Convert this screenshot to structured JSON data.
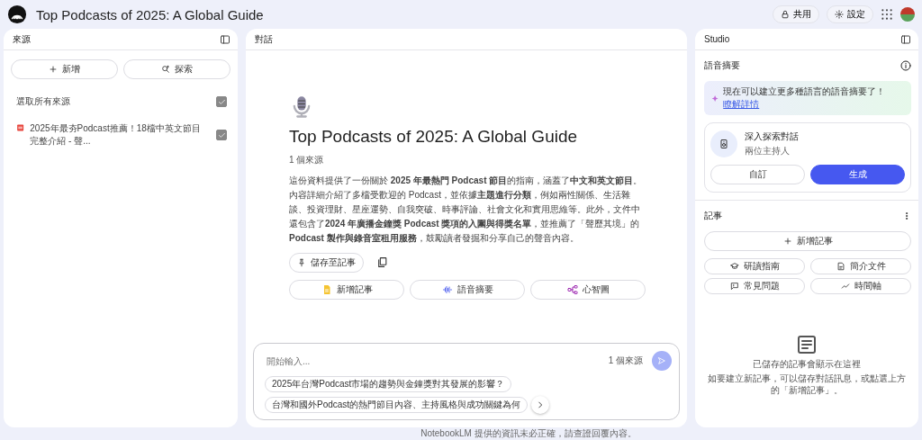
{
  "header": {
    "title": "Top Podcasts of 2025: A Global Guide",
    "buttons": [
      "共用",
      "設定"
    ]
  },
  "sources": {
    "title": "來源",
    "actions": [
      "新增",
      "探索"
    ],
    "select_all": {
      "label": "選取所有來源",
      "checked": true
    },
    "items": [
      {
        "title": "2025年最夯Podcast推薦！18檔中英文節目完整介紹 - 聲...",
        "checked": true
      }
    ]
  },
  "chat": {
    "title": "對話",
    "notebook_title": "Top Podcasts of 2025: A Global Guide",
    "source_count": "1 個來源",
    "summary": "這份資料提供了一份關於 **2025 年最熱門 Podcast 節目**的指南，涵蓋了**中文和英文節目**。內容詳細介紹了多檔受歡迎的 Podcast，並依據**主題進行分類**，例如兩性關係、生活雜談、投資理財、星座運勢、自我突破、時事評論、社會文化和實用思維等。此外，文件中還包含了**2024 年廣播金鐘獎 Podcast 獎項的入圍與得獎名單**，並推薦了「聲歷其境」的 **Podcast 製作與錄音室租用服務**，鼓勵讀者發掘和分享自己的聲音內容。",
    "save_button": "儲存至記事",
    "actions": [
      "新增記事",
      "語音摘要",
      "心智圖"
    ],
    "input": {
      "placeholder": "開始輸入...",
      "source_count": "1 個來源"
    },
    "suggestions": [
      "2025年台灣Podcast市場的趨勢與金鐘獎對其發展的影響？",
      "台灣和國外Podcast的熱門節目內容、主持風格與成功關鍵為何"
    ],
    "disclaimer": "NotebookLM 提供的資訊未必正確，請查證回覆內容。"
  },
  "studio": {
    "title": "Studio",
    "audio": {
      "title": "語音摘要",
      "banner": {
        "text": "現在可以建立更多種語言的語音摘要了！",
        "link": "瞭解詳情"
      },
      "card": {
        "title": "深入探索對話",
        "subtitle": "兩位主持人",
        "buttons": [
          "自訂",
          "生成"
        ]
      }
    },
    "notes": {
      "title": "記事",
      "add_button": "新增記事",
      "tools": [
        "研讀指南",
        "簡介文件",
        "常見問題",
        "時間軸"
      ],
      "empty_title": "已儲存的記事會顯示在這裡",
      "empty_hint": "如要建立新記事，可以儲存對話訊息，或點選上方的「新增記事」。"
    }
  }
}
